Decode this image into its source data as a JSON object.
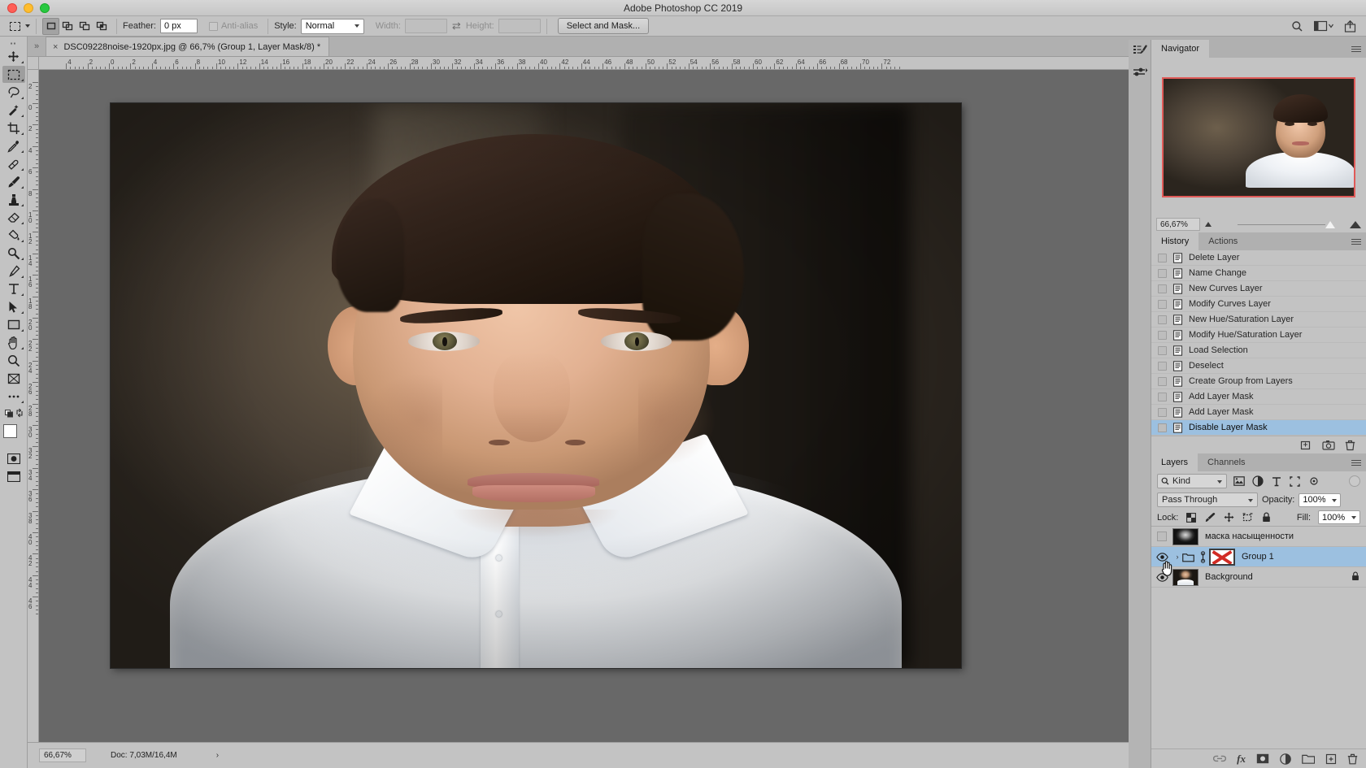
{
  "window": {
    "title": "Adobe Photoshop CC 2019",
    "traffic_lights": [
      "close",
      "minimize",
      "zoom"
    ]
  },
  "options_bar": {
    "tool_preset_icon": "rectangular-marquee-icon",
    "selection_modes": [
      "new-selection",
      "add-to-selection",
      "subtract-from-selection",
      "intersect-with-selection"
    ],
    "active_selection_mode": 0,
    "feather_label": "Feather:",
    "feather_value": "0 px",
    "antialias_label": "Anti-alias",
    "antialias_checked": false,
    "style_label": "Style:",
    "style_value": "Normal",
    "width_label": "Width:",
    "width_value": "",
    "swap_icon": "swap-arrows-icon",
    "height_label": "Height:",
    "height_value": "",
    "select_and_mask_label": "Select and Mask...",
    "right_icons": [
      "search-icon",
      "workspace-switcher-icon",
      "share-icon"
    ]
  },
  "toolbar": {
    "tools": [
      {
        "name": "move-tool",
        "selected": false
      },
      {
        "name": "rectangular-marquee-tool",
        "selected": true
      },
      {
        "name": "lasso-tool",
        "selected": false
      },
      {
        "name": "quick-selection-tool",
        "selected": false
      },
      {
        "name": "crop-tool",
        "selected": false
      },
      {
        "name": "eyedropper-tool",
        "selected": false
      },
      {
        "name": "spot-healing-brush-tool",
        "selected": false
      },
      {
        "name": "brush-tool",
        "selected": false
      },
      {
        "name": "clone-stamp-tool",
        "selected": false
      },
      {
        "name": "eraser-tool",
        "selected": false
      },
      {
        "name": "gradient-tool",
        "selected": false
      },
      {
        "name": "dodge-tool",
        "selected": false
      },
      {
        "name": "pen-tool",
        "selected": false
      },
      {
        "name": "type-tool",
        "selected": false
      },
      {
        "name": "path-selection-tool",
        "selected": false
      },
      {
        "name": "rectangle-tool",
        "selected": false
      },
      {
        "name": "hand-tool",
        "selected": false
      },
      {
        "name": "zoom-tool",
        "selected": false
      },
      {
        "name": "edit-toolbar-tool",
        "selected": false
      }
    ],
    "more_tools_label": "...",
    "foreground_color": "#ffffff",
    "background_color": "#000000",
    "quick_mask_label": "quick-mask-icon",
    "screen_mode_label": "screen-mode-icon"
  },
  "document": {
    "tab_title": "DSC09228noise-1920px.jpg @ 66,7% (Group 1, Layer Mask/8) *",
    "close_label": "×"
  },
  "rulers": {
    "unit": "cm",
    "horizontal_labels": [
      "4",
      "2",
      "0",
      "2",
      "4",
      "6",
      "8",
      "10",
      "12",
      "14",
      "16",
      "18",
      "20",
      "22",
      "24",
      "26",
      "28",
      "30",
      "32",
      "34",
      "36",
      "38",
      "40",
      "42",
      "44",
      "46",
      "48",
      "50",
      "52",
      "54",
      "56",
      "58",
      "60",
      "62",
      "64",
      "66",
      "68",
      "70",
      "72"
    ],
    "vertical_labels": [
      "2",
      "0",
      "2",
      "4",
      "6",
      "8",
      "10",
      "12",
      "14",
      "16",
      "18",
      "20",
      "22",
      "24",
      "26",
      "28",
      "30",
      "32",
      "34",
      "36",
      "38",
      "40",
      "42",
      "44",
      "46"
    ]
  },
  "status_bar": {
    "zoom": "66,67%",
    "doc_info": "Doc: 7,03M/16,4M",
    "expand_arrow": "›"
  },
  "navigator": {
    "tab_label": "Navigator",
    "zoom_value": "66,67%",
    "zoom_out_icon": "small-mountain-icon",
    "zoom_in_icon": "large-mountain-icon",
    "slider_position_percent": 68
  },
  "history": {
    "tabs": [
      {
        "label": "History",
        "active": true
      },
      {
        "label": "Actions",
        "active": false
      }
    ],
    "items": [
      {
        "label": "Delete Layer",
        "selected": false
      },
      {
        "label": "Name Change",
        "selected": false
      },
      {
        "label": "New Curves Layer",
        "selected": false
      },
      {
        "label": "Modify Curves Layer",
        "selected": false
      },
      {
        "label": "New Hue/Saturation Layer",
        "selected": false
      },
      {
        "label": "Modify Hue/Saturation Layer",
        "selected": false
      },
      {
        "label": "Load Selection",
        "selected": false
      },
      {
        "label": "Deselect",
        "selected": false
      },
      {
        "label": "Create Group from Layers",
        "selected": false
      },
      {
        "label": "Add Layer Mask",
        "selected": false
      },
      {
        "label": "Add Layer Mask",
        "selected": false
      },
      {
        "label": "Disable Layer Mask",
        "selected": true
      }
    ],
    "footer_icons": [
      "create-document-from-state-icon",
      "create-new-snapshot-icon",
      "delete-state-icon"
    ]
  },
  "layers": {
    "tabs": [
      {
        "label": "Layers",
        "active": true
      },
      {
        "label": "Channels",
        "active": false
      }
    ],
    "filter_kind_label": "Kind",
    "filter_icons": [
      "pixel-layer-filter-icon",
      "adjustment-layer-filter-icon",
      "type-layer-filter-icon",
      "shape-layer-filter-icon",
      "smart-object-filter-icon"
    ],
    "filter_toggle_icon": "filter-on-off-toggle",
    "blend_mode": "Pass Through",
    "opacity_label": "Opacity:",
    "opacity_value": "100%",
    "lock_label": "Lock:",
    "lock_icons": [
      "lock-transparent-pixels-icon",
      "lock-image-pixels-icon",
      "lock-position-icon",
      "lock-artboard-nesting-icon",
      "lock-all-icon"
    ],
    "fill_label": "Fill:",
    "fill_value": "100%",
    "rows": [
      {
        "name": "маска насыщенности",
        "visible": false,
        "selected": false,
        "type": "layer",
        "thumb": "grayscale-portrait-thumbnail",
        "locked": false
      },
      {
        "name": "Group 1",
        "visible": true,
        "selected": true,
        "type": "group",
        "expand_icon": "chevron-right-icon",
        "folder_icon": "folder-icon",
        "link_icon": "link-mask-icon",
        "thumb": "disabled-layer-mask-red-x",
        "locked": false
      },
      {
        "name": "Background",
        "visible": true,
        "selected": false,
        "type": "layer",
        "thumb": "color-portrait-thumbnail",
        "locked": true
      }
    ],
    "footer_icons": [
      "link-layers-icon",
      "layer-style-fx-icon",
      "add-layer-mask-icon",
      "new-adjustment-layer-icon",
      "new-group-icon",
      "new-layer-icon",
      "delete-layer-icon"
    ]
  },
  "icon_strip": {
    "items": [
      "brush-presets-icon",
      "brush-settings-icon"
    ]
  },
  "colors": {
    "chrome": "#c3c3c3",
    "dock": "#b0b0b0",
    "canvas_bg": "#686868",
    "selection_blue": "#9cc0e0",
    "navigator_frame": "#e05a58",
    "mask_red": "#d12b24"
  }
}
